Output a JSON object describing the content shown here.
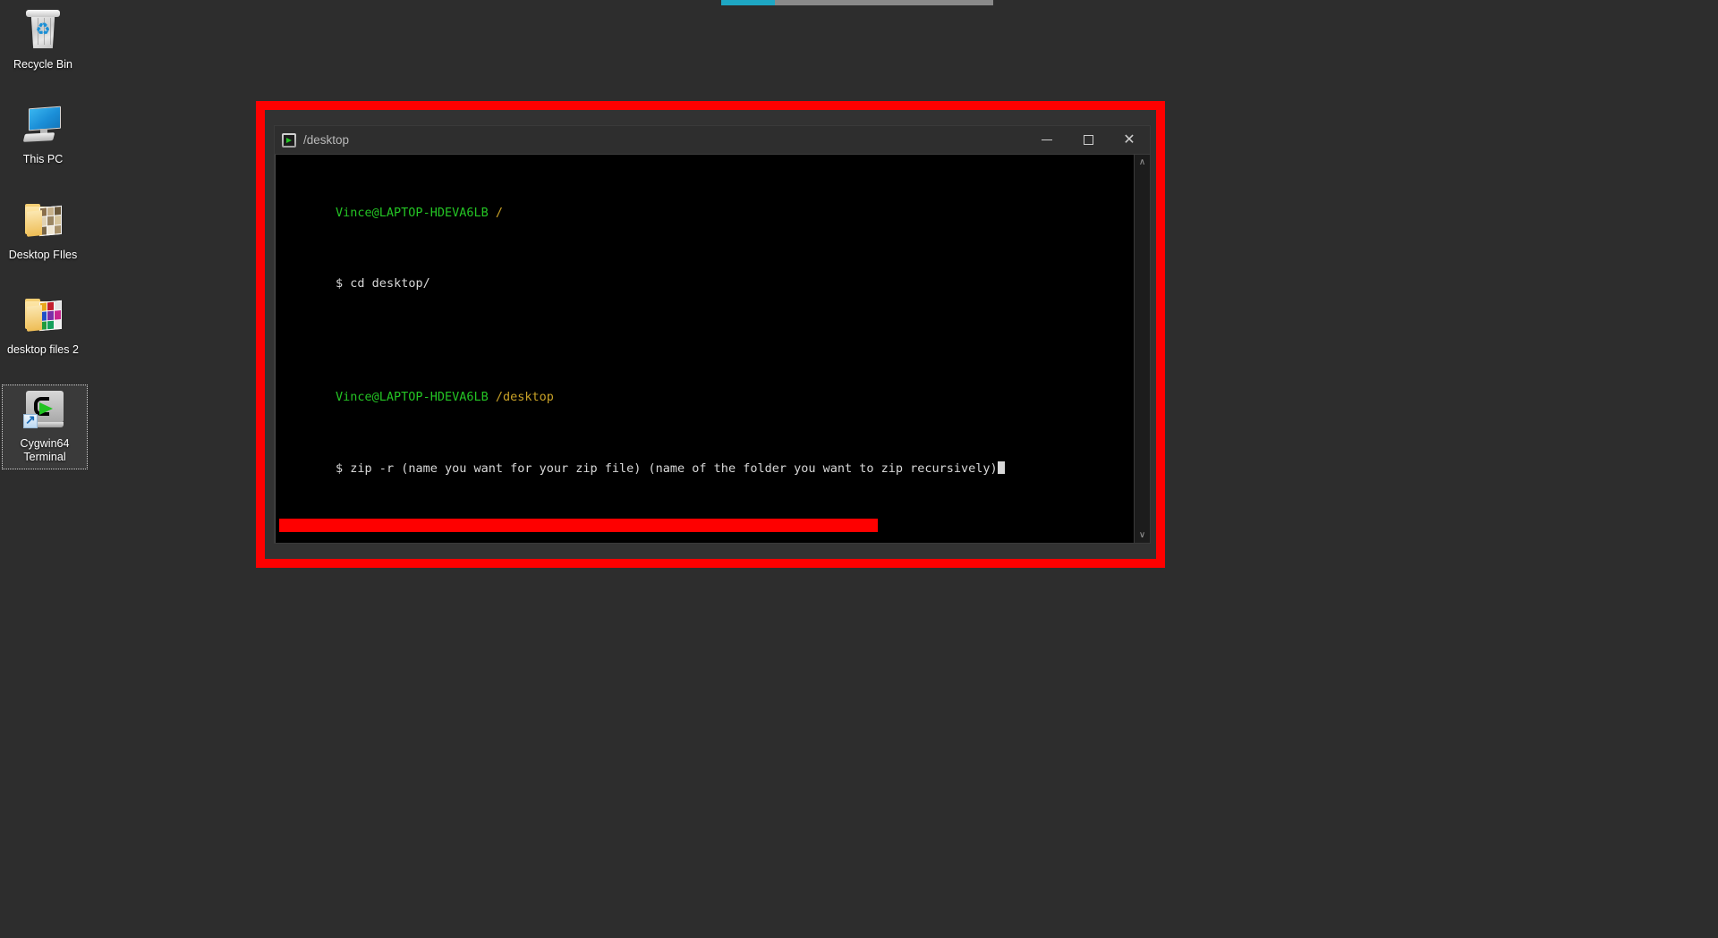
{
  "desktop": {
    "background_color": "#2d2d2d",
    "icons": [
      {
        "name": "recycle-bin",
        "label": "Recycle Bin",
        "icon": "recycle-bin-icon",
        "selected": false
      },
      {
        "name": "this-pc",
        "label": "This PC",
        "icon": "computer-monitor-icon",
        "selected": false
      },
      {
        "name": "desktop-files",
        "label": "Desktop FIles",
        "icon": "folder-icon",
        "selected": false
      },
      {
        "name": "desktop-files-2",
        "label": "desktop files 2",
        "icon": "folder-pictures-icon",
        "selected": false
      },
      {
        "name": "cygwin64-terminal",
        "label": "Cygwin64 Terminal",
        "icon": "cygwin-terminal-icon",
        "selected": true
      }
    ]
  },
  "annotation": {
    "highlight_color": "#fe0000",
    "border_width_px": 10
  },
  "window": {
    "title": "/desktop",
    "app_icon": "cygwin-terminal-icon",
    "controls": {
      "minimize_label": "—",
      "maximize_label": "□",
      "close_label": "✕"
    },
    "scrollbar": {
      "up_arrow": "∧",
      "down_arrow": "∨"
    }
  },
  "terminal": {
    "background_color": "#000000",
    "prompt_user_color": "#24c424",
    "prompt_path_color": "#c9a227",
    "text_color": "#d8d8d8",
    "blocks": [
      {
        "id": "block-1",
        "prompt_user": "Vince@LAPTOP-HDEVA6LB",
        "prompt_path": "/",
        "prompt_sigil": "$",
        "command": " cd desktop/"
      },
      {
        "id": "block-2",
        "prompt_user": "Vince@LAPTOP-HDEVA6LB",
        "prompt_path": "/desktop",
        "prompt_sigil": "$",
        "command": " zip -r (name you want for your zip file) (name of the folder you want to zip recursively)"
      }
    ],
    "cursor_visible": true,
    "highlight_bar_color": "#fe0000"
  }
}
